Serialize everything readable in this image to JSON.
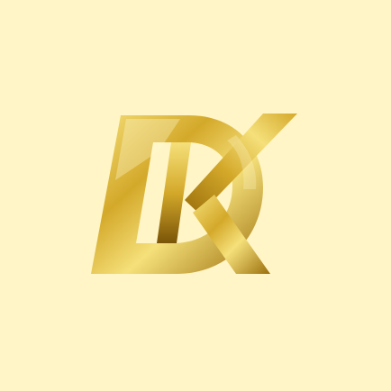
{
  "logo": {
    "lettering": "DK",
    "icon": "dk-monogram-logo-icon"
  },
  "colors": {
    "background": "#fff5c6",
    "gold_light": "#f5e07a",
    "gold_mid": "#d4a92a",
    "gold_dark": "#9a6e0c",
    "gold_deep": "#7a5408"
  }
}
